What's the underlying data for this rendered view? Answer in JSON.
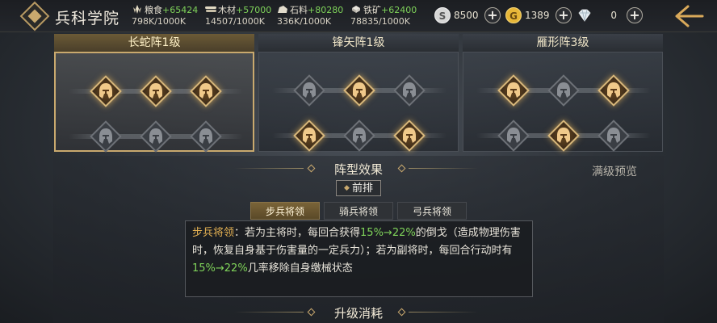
{
  "header": {
    "title": "兵科学院",
    "resources": [
      {
        "icon": "grain-icon",
        "name": "粮食",
        "gain": "+65424",
        "cap": "798K/1000K"
      },
      {
        "icon": "wood-icon",
        "name": "木材",
        "gain": "+57000",
        "cap": "14507/1000K"
      },
      {
        "icon": "stone-icon",
        "name": "石料",
        "gain": "+80280",
        "cap": "336K/1000K"
      },
      {
        "icon": "iron-icon",
        "name": "铁矿",
        "gain": "+62400",
        "cap": "78835/1000K"
      }
    ],
    "currencies": [
      {
        "icon": "silver-coin-icon",
        "value": "8500"
      },
      {
        "icon": "gold-coin-icon",
        "value": "1389"
      },
      {
        "icon": "diamond-icon",
        "value": "0"
      }
    ],
    "plus_label": "+"
  },
  "formations": [
    {
      "name": "长蛇阵1级",
      "selected": true,
      "slots": [
        [
          1,
          1,
          1
        ],
        [
          0,
          0,
          0
        ]
      ]
    },
    {
      "name": "锋矢阵1级",
      "selected": false,
      "slots": [
        [
          0,
          1,
          0
        ],
        [
          1,
          0,
          1
        ]
      ]
    },
    {
      "name": "雁形阵3级",
      "selected": false,
      "slots": [
        [
          1,
          0,
          1
        ],
        [
          0,
          1,
          0
        ]
      ]
    }
  ],
  "effect": {
    "title": "阵型效果",
    "preview_label": "满级预览",
    "position_tag": "前排",
    "tabs": [
      "步兵将领",
      "骑兵将领",
      "弓兵将领"
    ],
    "selected_tab": 0,
    "desc": {
      "label": "步兵将领",
      "p1": "：若为主将时，每回合获得",
      "v1": "15%→22%",
      "p2": "的倒戈（造成物理伤害时，恢复自身基于伤害量的一定兵力）；若为副将时，每回合行动时有",
      "v2": "15%→22%",
      "p3": "几率移除自身缴械状态"
    }
  },
  "upgrade": {
    "title": "升级消耗"
  },
  "colors": {
    "gold": "#c9a96e",
    "gain_green": "#7fd35a",
    "highlight": "#e5b253"
  }
}
